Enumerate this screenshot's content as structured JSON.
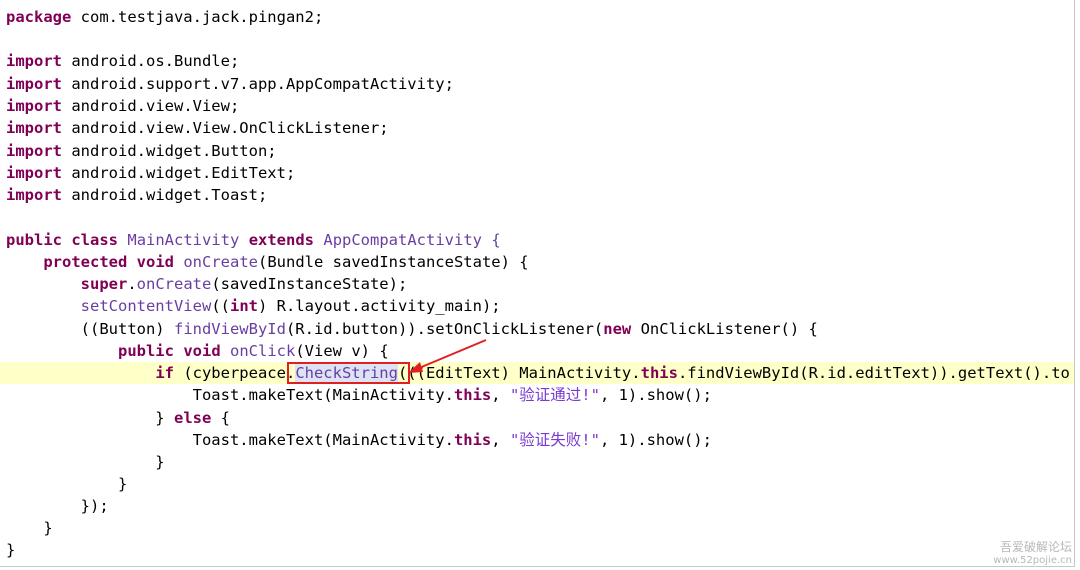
{
  "code": {
    "package_kw": "package",
    "package_name": " com.testjava.jack.pingan2;",
    "import_kw": "import",
    "imports": [
      " android.os.Bundle;",
      " android.support.v7.app.AppCompatActivity;",
      " android.view.View;",
      " android.view.View.OnClickListener;",
      " android.widget.Button;",
      " android.widget.EditText;",
      " android.widget.Toast;"
    ],
    "class_decl": [
      "public",
      " ",
      "class",
      " ",
      "MainActivity",
      " ",
      "extends",
      " ",
      "AppCompatActivity {"
    ],
    "oncreate": [
      "    ",
      "protected",
      " ",
      "void",
      " ",
      "onCreate",
      "(Bundle savedInstanceState) {"
    ],
    "super_line": [
      "        ",
      "super",
      ".",
      "onCreate",
      "(savedInstanceState);"
    ],
    "setcontent": [
      "        ",
      "setContentView",
      "((",
      "int",
      ") R.layout.activity_main);"
    ],
    "button_line": [
      "        ((Button) ",
      "findViewById",
      "(R.id.button)).setOnClickListener(",
      "new",
      " OnClickListener() {"
    ],
    "onclick": [
      "            ",
      "public",
      " ",
      "void",
      " ",
      "onClick",
      "(View v) {"
    ],
    "if_line": [
      "                ",
      "if",
      " (cyberpeace.",
      "CheckString",
      "(((EditText) MainActivity.",
      "this",
      ".findViewById(R.id.editText)).getText().to"
    ],
    "toast_ok": [
      "                    Toast.makeText(MainActivity.",
      "this",
      ", ",
      "\"验证通过!\"",
      ", 1).show();"
    ],
    "else_line": [
      "                } ",
      "else",
      " {"
    ],
    "toast_fail": [
      "                    Toast.makeText(MainActivity.",
      "this",
      ", ",
      "\"验证失败!\"",
      ", 1).show();"
    ],
    "close1": "                }",
    "close2": "            }",
    "close3": "        });",
    "close4": "    }",
    "close5": "}"
  },
  "watermark": {
    "line1": "吾爱破解论坛",
    "line2": "www.52pojie.cn"
  }
}
